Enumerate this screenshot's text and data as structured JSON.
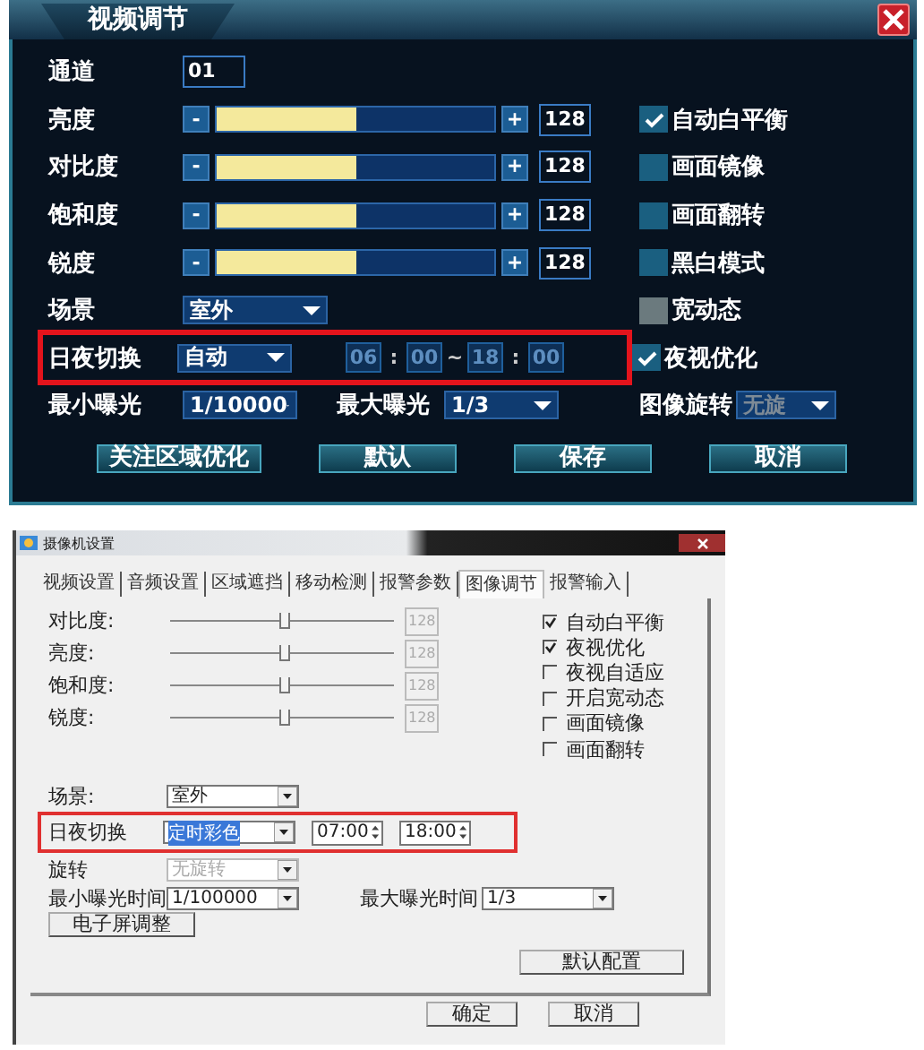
{
  "video_panel": {
    "title": "视频调节",
    "channel": {
      "label": "通道",
      "value": "01"
    },
    "sliders": [
      {
        "label": "亮度",
        "minus": "-",
        "plus": "+",
        "level": 0.5,
        "value": "128"
      },
      {
        "label": "对比度",
        "minus": "-",
        "plus": "+",
        "level": 0.5,
        "value": "128"
      },
      {
        "label": "饱和度",
        "minus": "-",
        "plus": "+",
        "level": 0.5,
        "value": "128"
      },
      {
        "label": "锐度",
        "minus": "-",
        "plus": "+",
        "level": 0.5,
        "value": "128"
      }
    ],
    "scene": {
      "label": "场景",
      "value": "室外"
    },
    "day_night": {
      "label": "日夜切换",
      "value": "自动",
      "highlighted": true,
      "time_parts": [
        {
          "kind": "field",
          "text": "06"
        },
        {
          "kind": "separator",
          "text": ":"
        },
        {
          "kind": "field",
          "text": "00"
        },
        {
          "kind": "separator",
          "text": "~"
        },
        {
          "kind": "field",
          "text": "18"
        },
        {
          "kind": "separator",
          "text": ":"
        },
        {
          "kind": "field",
          "text": "00"
        }
      ]
    },
    "min_exposure": {
      "label": "最小曝光",
      "value": "1/10000"
    },
    "max_exposure": {
      "label": "最大曝光",
      "value": "1/3"
    },
    "checkboxes": [
      {
        "label": "自动白平衡",
        "checked": true,
        "disabled": false
      },
      {
        "label": "画面镜像",
        "checked": false,
        "disabled": false
      },
      {
        "label": "画面翻转",
        "checked": false,
        "disabled": false
      },
      {
        "label": "黑白模式",
        "checked": false,
        "disabled": false
      },
      {
        "label": "宽动态",
        "checked": false,
        "disabled": true
      },
      {
        "label": "夜视优化",
        "checked": true,
        "disabled": false
      }
    ],
    "rotation": {
      "label": "图像旋转",
      "value": "无旋",
      "disabled": true
    },
    "buttons": [
      "关注区域优化",
      "默认",
      "保存",
      "取消"
    ]
  },
  "camera_window": {
    "title": "摄像机设置",
    "tabs": [
      {
        "label": "视频设置",
        "selected": false
      },
      {
        "label": "音频设置",
        "selected": false
      },
      {
        "label": "区域遮挡",
        "selected": false
      },
      {
        "label": "移动检测",
        "selected": false
      },
      {
        "label": "报警参数",
        "selected": false
      },
      {
        "label": "图像调节",
        "selected": true
      },
      {
        "label": "报警输入",
        "selected": false
      }
    ],
    "sliders": [
      {
        "label": "对比度:",
        "level": 0.5,
        "value": "128"
      },
      {
        "label": "亮度:",
        "level": 0.5,
        "value": "128"
      },
      {
        "label": "饱和度:",
        "level": 0.5,
        "value": "128"
      },
      {
        "label": "锐度:",
        "level": 0.5,
        "value": "128"
      }
    ],
    "checkboxes": [
      {
        "label": "自动白平衡",
        "checked": true
      },
      {
        "label": "夜视优化",
        "checked": true
      },
      {
        "label": "夜视自适应",
        "checked": false
      },
      {
        "label": "开启宽动态",
        "checked": false
      },
      {
        "label": "画面镜像",
        "checked": false
      },
      {
        "label": "画面翻转",
        "checked": false
      }
    ],
    "scene": {
      "label": "场景:",
      "value": "室外"
    },
    "day_night": {
      "label": "日夜切换",
      "value": "定时彩色",
      "highlighted": true,
      "start": "07:00",
      "end": "18:00"
    },
    "rotation": {
      "label": "旋转",
      "value": "无旋转",
      "disabled": true
    },
    "min_exposure": {
      "label": "最小曝光时间",
      "value": "1/100000"
    },
    "max_exposure": {
      "label": "最大曝光时间",
      "value": "1/3"
    },
    "screen_button": "电子屏调整",
    "default_button": "默认配置",
    "footer_buttons": [
      "确定",
      "取消"
    ]
  }
}
